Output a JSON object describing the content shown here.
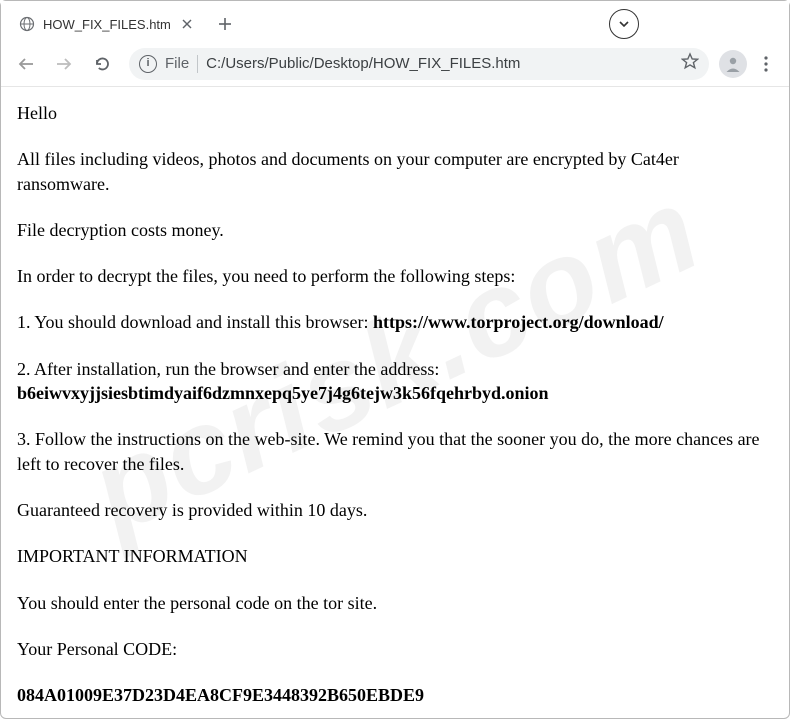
{
  "window": {
    "tab_title": "HOW_FIX_FILES.htm",
    "file_chip": "File",
    "url": "C:/Users/Public/Desktop/HOW_FIX_FILES.htm"
  },
  "page": {
    "hello": "Hello",
    "intro": "All files including videos, photos and documents on your computer are encrypted by Cat4er ransomware.",
    "cost": "File decryption costs money.",
    "steps_intro": "In order to decrypt the files, you need to perform the following steps:",
    "step1_prefix": "1. You should download and install this browser: ",
    "step1_link": "https://www.torproject.org/download/",
    "step2_line1": "2. After installation, run the browser and enter the address:",
    "step2_onion": "b6eiwvxyjjsiesbtimdyaif6dzmnxepq5ye7j4g6tejw3k56fqehrbyd.onion",
    "step3": "3. Follow the instructions on the web-site. We remind you that the sooner you do, the more chances are left to recover the files.",
    "guarantee": "Guaranteed recovery is provided within 10 days.",
    "important": "IMPORTANT INFORMATION",
    "enter_code": "You should enter the personal code on the tor site.",
    "code_label": "Your Personal CODE:",
    "code_value": "084A01009E37D23D4EA8CF9E3448392B650EBDE9"
  },
  "watermark": "pcrisk.com"
}
